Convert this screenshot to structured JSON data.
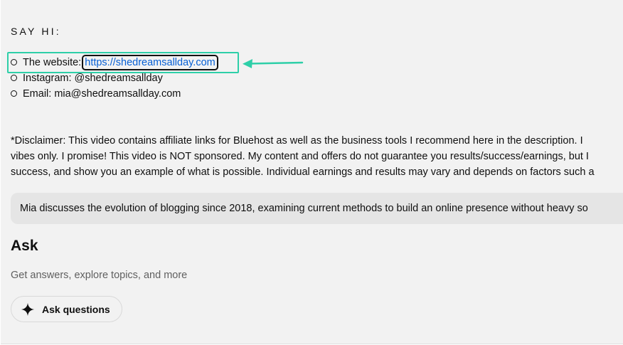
{
  "social": {
    "heading": "SAY HI:",
    "website_label": "The website: ",
    "website_url": "https://shedreamsallday.com",
    "instagram": "Instagram: @shedreamsallday",
    "email": "Email: mia@shedreamsallday.com"
  },
  "description": {
    "disclaimer_lines": [
      "*Disclaimer: This video contains affiliate links for Bluehost as well as the business tools I recommend here in the description. I",
      "vibes only. I promise! This video is NOT sponsored. My content and offers do not guarantee you results/success/earnings, but I",
      "success, and show you an example of what is possible. Individual earnings and results may vary and depends on factors such a"
    ]
  },
  "summary": {
    "text": "Mia discusses the evolution of blogging since 2018, examining current methods to build an online presence without heavy so"
  },
  "ask": {
    "title": "Ask",
    "subtitle": "Get answers, explore topics, and more",
    "button_label": "Ask questions",
    "button_icon": "sparkle-icon"
  },
  "annotation": {
    "highlight_color": "#2ecfa8",
    "arrow_icon": "arrow-left-icon"
  },
  "colors": {
    "link": "#065fd4",
    "panel_bg": "#f2f2f2",
    "summary_bg": "#e5e5e5"
  }
}
